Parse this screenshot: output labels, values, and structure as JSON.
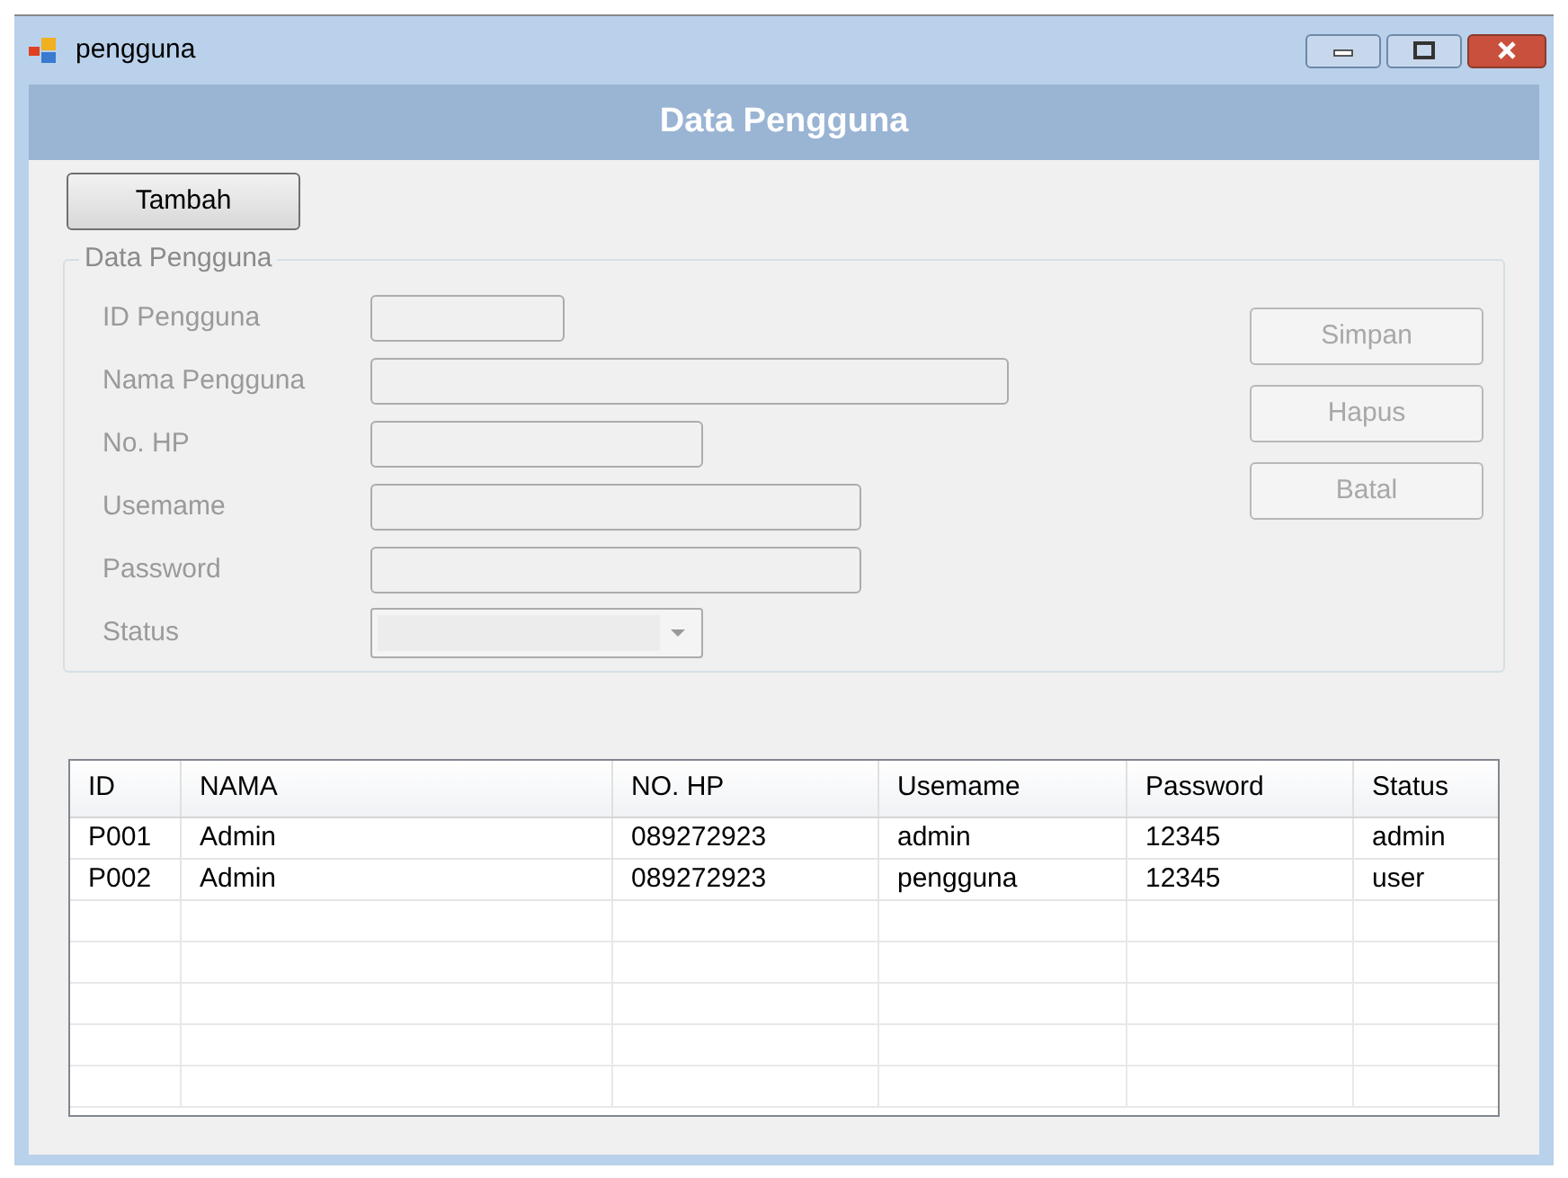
{
  "window": {
    "title": "pengguna"
  },
  "header": {
    "title": "Data Pengguna"
  },
  "add_button": {
    "label": "Tambah"
  },
  "form": {
    "title": "Data Pengguna",
    "fields": [
      {
        "kind": "text",
        "label": "ID Pengguna",
        "disabled": true
      },
      {
        "kind": "text",
        "label": "Nama Pengguna",
        "disabled": true
      },
      {
        "kind": "text",
        "label": "No. HP",
        "disabled": true
      },
      {
        "kind": "text",
        "label": "Usemame",
        "disabled": true
      },
      {
        "kind": "text",
        "label": "Password",
        "disabled": true
      },
      {
        "kind": "combo",
        "label": "Status",
        "disabled": true
      }
    ],
    "buttons": [
      {
        "label": "Simpan",
        "disabled": true
      },
      {
        "label": "Hapus",
        "disabled": true
      },
      {
        "label": "Batal",
        "disabled": true
      }
    ]
  },
  "table": {
    "columns": [
      "ID",
      "NAMA",
      "NO. HP",
      "Usemame",
      "Password",
      "Status"
    ],
    "rows": [
      [
        "P001",
        "Admin",
        "089272923",
        "admin",
        "12345",
        "admin"
      ],
      [
        "P002",
        "Admin",
        "089272923",
        "pengguna",
        "12345",
        "user"
      ]
    ]
  }
}
